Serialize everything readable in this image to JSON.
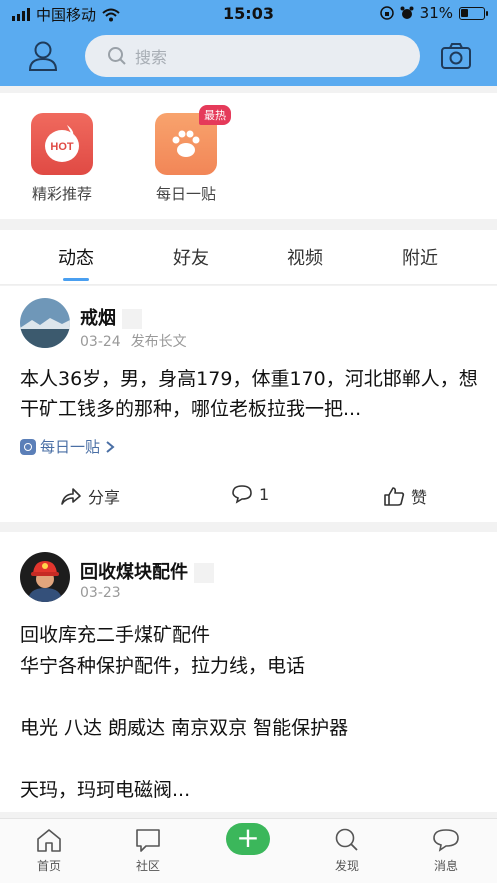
{
  "status_bar": {
    "carrier": "中国移动",
    "time": "15:03",
    "battery": "31%"
  },
  "header": {
    "search_placeholder": "搜索"
  },
  "quick_tiles": [
    {
      "label": "精彩推荐",
      "icon": "hot-icon",
      "icon_text": "HOT"
    },
    {
      "label": "每日一贴",
      "icon": "paw-icon",
      "badge": "最热"
    }
  ],
  "tabs": [
    "动态",
    "好友",
    "视频",
    "附近"
  ],
  "posts": [
    {
      "author": "戒烟",
      "date": "03-24",
      "meta": "发布长文",
      "body": "本人36岁，男，身高179，体重170，河北邯郸人，想干矿工钱多的那种，哪位老板拉我一把...",
      "tag": "每日一贴",
      "share_label": "分享",
      "comment_count": "1",
      "like_label": "赞"
    },
    {
      "author": "回收煤块配件",
      "date": "03-23",
      "lines": [
        "回收库充二手煤矿配件",
        "华宁各种保护配件，拉力线，电话",
        "",
        "电光 八达 朗威达 南京双京 智能保护器",
        "",
        "天玛，玛珂电磁阀..."
      ]
    }
  ],
  "bottom_nav": {
    "home": "首页",
    "community": "社区",
    "discover": "发现",
    "messages": "消息",
    "plus": "+"
  },
  "colors": {
    "header": "#5aabf0",
    "accent": "#4a9ff0",
    "plus_button": "#3bb75b",
    "badge": "#e53a5a"
  }
}
